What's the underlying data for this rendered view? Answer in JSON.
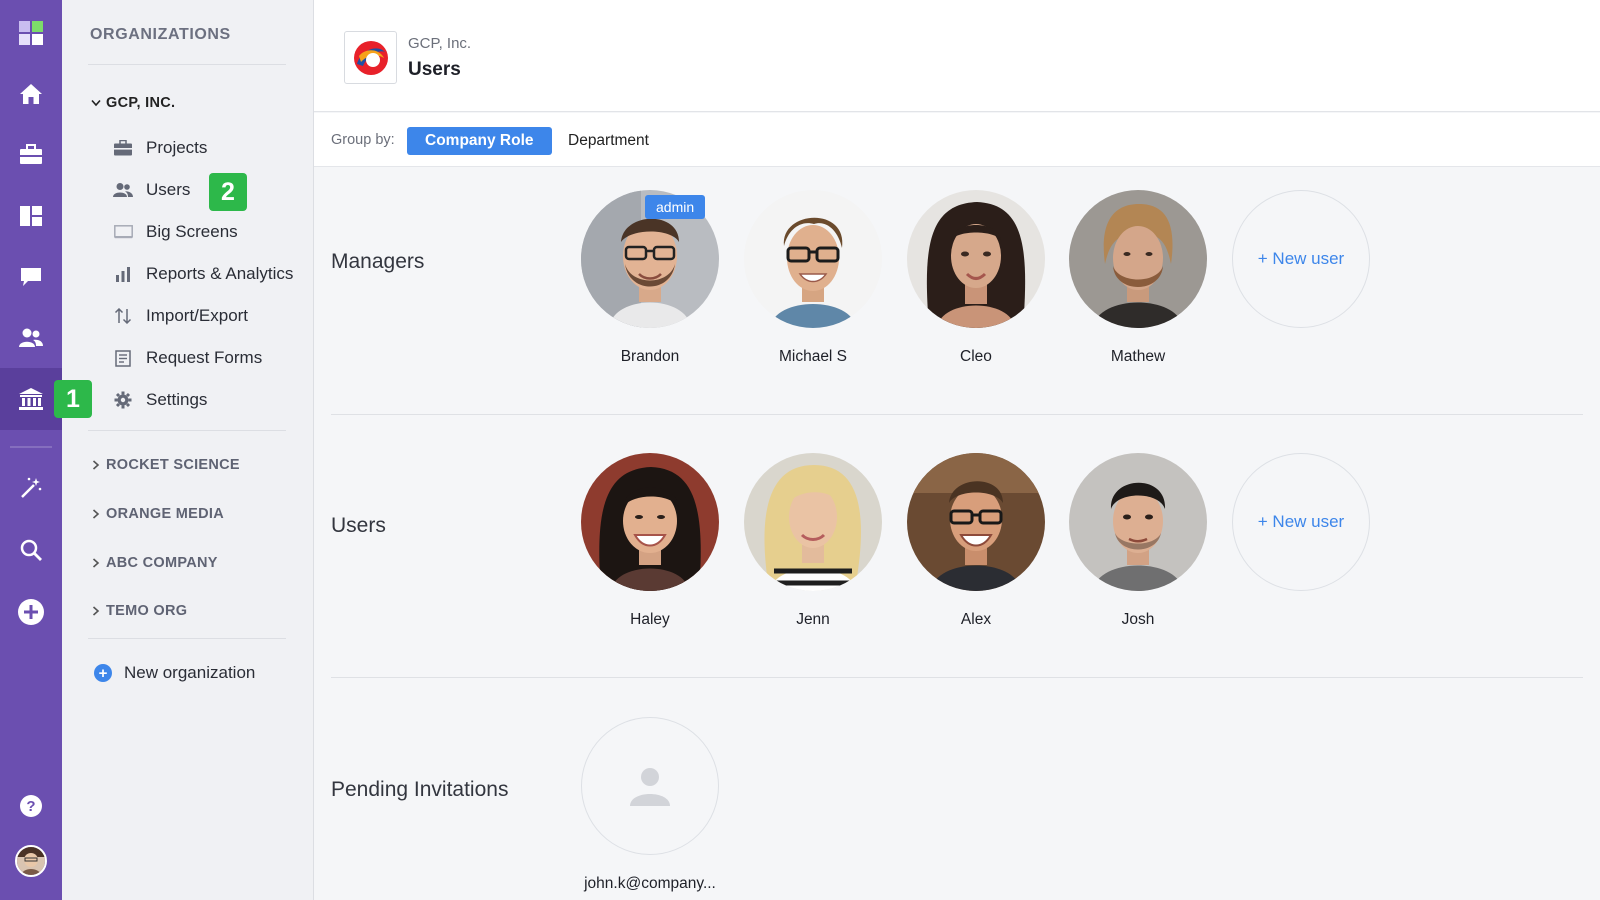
{
  "rail": {
    "items": [
      {
        "icon": "app-logo-icon"
      },
      {
        "icon": "home-icon"
      },
      {
        "icon": "briefcase-icon"
      },
      {
        "icon": "board-icon"
      },
      {
        "icon": "chat-icon"
      },
      {
        "icon": "people-icon"
      },
      {
        "icon": "bank-icon",
        "active": true
      },
      {
        "icon": "magic-wand-icon"
      },
      {
        "icon": "search-icon"
      },
      {
        "icon": "add-circle-icon"
      },
      {
        "icon": "help-icon"
      },
      {
        "icon": "user-avatar"
      }
    ],
    "step1_badge": "1",
    "step2_badge": "2",
    "accent": "#6b4fb0",
    "badge_color": "#2db84a"
  },
  "sidebar": {
    "heading": "ORGANIZATIONS",
    "current_org": "GCP, INC.",
    "nav": [
      {
        "label": "Projects",
        "icon": "briefcase-icon"
      },
      {
        "label": "Users",
        "icon": "users-icon"
      },
      {
        "label": "Big Screens",
        "icon": "monitor-icon"
      },
      {
        "label": "Reports & Analytics",
        "icon": "bar-chart-icon"
      },
      {
        "label": "Import/Export",
        "icon": "swap-arrows-icon"
      },
      {
        "label": "Request Forms",
        "icon": "form-icon"
      },
      {
        "label": "Settings",
        "icon": "gear-icon"
      }
    ],
    "other_orgs": [
      "ROCKET SCIENCE",
      "ORANGE MEDIA",
      "ABC COMPANY",
      "TEMO ORG"
    ],
    "new_org_label": "New organization"
  },
  "header": {
    "breadcrumb": "GCP, Inc.",
    "title": "Users"
  },
  "group_by": {
    "label": "Group by:",
    "options": [
      "Company Role",
      "Department"
    ],
    "selected": "Company Role",
    "accent": "#3d86ea"
  },
  "groups": {
    "managers": {
      "label": "Managers",
      "people": [
        {
          "name": "Brandon",
          "tag": "admin"
        },
        {
          "name": "Michael S"
        },
        {
          "name": "Cleo"
        },
        {
          "name": "Mathew"
        }
      ],
      "new_user_label": "+ New user"
    },
    "users": {
      "label": "Users",
      "people": [
        {
          "name": "Haley"
        },
        {
          "name": "Jenn"
        },
        {
          "name": "Alex"
        },
        {
          "name": "Josh"
        }
      ],
      "new_user_label": "+ New user"
    },
    "pending": {
      "label": "Pending Invitations",
      "invites": [
        {
          "email": "john.k@company..."
        }
      ]
    }
  }
}
